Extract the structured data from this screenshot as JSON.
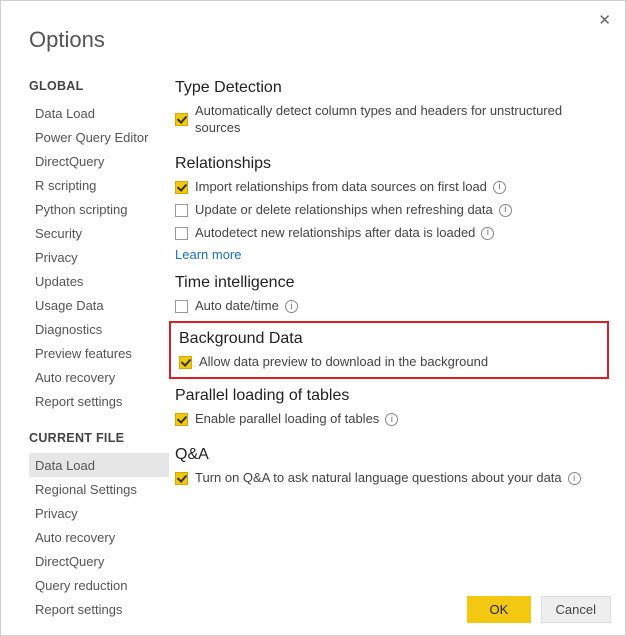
{
  "dialog": {
    "title": "Options",
    "close_glyph": "✕"
  },
  "sidebar": {
    "global_header": "GLOBAL",
    "current_header": "CURRENT FILE",
    "global_items": [
      "Data Load",
      "Power Query Editor",
      "DirectQuery",
      "R scripting",
      "Python scripting",
      "Security",
      "Privacy",
      "Updates",
      "Usage Data",
      "Diagnostics",
      "Preview features",
      "Auto recovery",
      "Report settings"
    ],
    "current_items": [
      "Data Load",
      "Regional Settings",
      "Privacy",
      "Auto recovery",
      "DirectQuery",
      "Query reduction",
      "Report settings"
    ],
    "active": "Data Load"
  },
  "groups": {
    "type_detection": {
      "title": "Type Detection",
      "opt1": {
        "label": "Automatically detect column types and headers for unstructured sources",
        "checked": true,
        "info": false
      }
    },
    "relationships": {
      "title": "Relationships",
      "opt1": {
        "label": "Import relationships from data sources on first load",
        "checked": true,
        "info": true
      },
      "opt2": {
        "label": "Update or delete relationships when refreshing data",
        "checked": false,
        "info": true
      },
      "opt3": {
        "label": "Autodetect new relationships after data is loaded",
        "checked": false,
        "info": true
      },
      "learn_more": "Learn more"
    },
    "time_intel": {
      "title": "Time intelligence",
      "opt1": {
        "label": "Auto date/time",
        "checked": false,
        "info": true
      }
    },
    "bg_data": {
      "title": "Background Data",
      "opt1": {
        "label": "Allow data preview to download in the background",
        "checked": true,
        "info": false
      }
    },
    "parallel": {
      "title": "Parallel loading of tables",
      "opt1": {
        "label": "Enable parallel loading of tables",
        "checked": true,
        "info": true
      }
    },
    "qa": {
      "title": "Q&A",
      "opt1": {
        "label": "Turn on Q&A to ask natural language questions about your data",
        "checked": true,
        "info": true
      }
    }
  },
  "footer": {
    "ok": "OK",
    "cancel": "Cancel"
  },
  "info_glyph": "i"
}
